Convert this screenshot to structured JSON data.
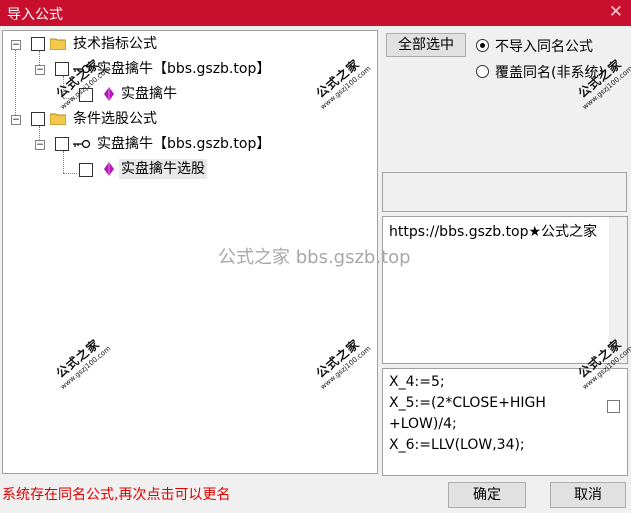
{
  "window": {
    "title": "导入公式",
    "close_glyph": "✕"
  },
  "tree": {
    "root1_label": "技术指标公式",
    "root1_child_label": "实盘擒牛【bbs.gszb.top】",
    "root1_grandchild_label": "实盘擒牛",
    "root2_label": "条件选股公式",
    "root2_child_label": "实盘擒牛【bbs.gszb.top】",
    "root2_grandchild_label": "实盘擒牛选股"
  },
  "actions": {
    "select_all_label": "全部选中",
    "ok_label": "确定",
    "cancel_label": "取消"
  },
  "options": {
    "no_import_same_name": "不导入同名公式",
    "overwrite_same_name": "覆盖同名(非系统)",
    "selected": "no_import_same_name"
  },
  "info_text": "https://bbs.gszb.top★公式之家",
  "code_lines": [
    "X_4:=5;",
    "X_5:=(2*CLOSE+HIGH",
    "+LOW)/4;",
    "X_6:=LLV(LOW,34);"
  ],
  "status_message": "系统存在同名公式,再次点击可以更名",
  "watermark": {
    "center_text": "公式之家 bbs.gszb.top",
    "stamp_big": "公式之家",
    "stamp_small": "www.gszj100.com"
  },
  "colors": {
    "titlebar": "#c8102e",
    "status_text": "#e00000",
    "gem": "#b31ab3",
    "folder": "#f2c94c"
  }
}
